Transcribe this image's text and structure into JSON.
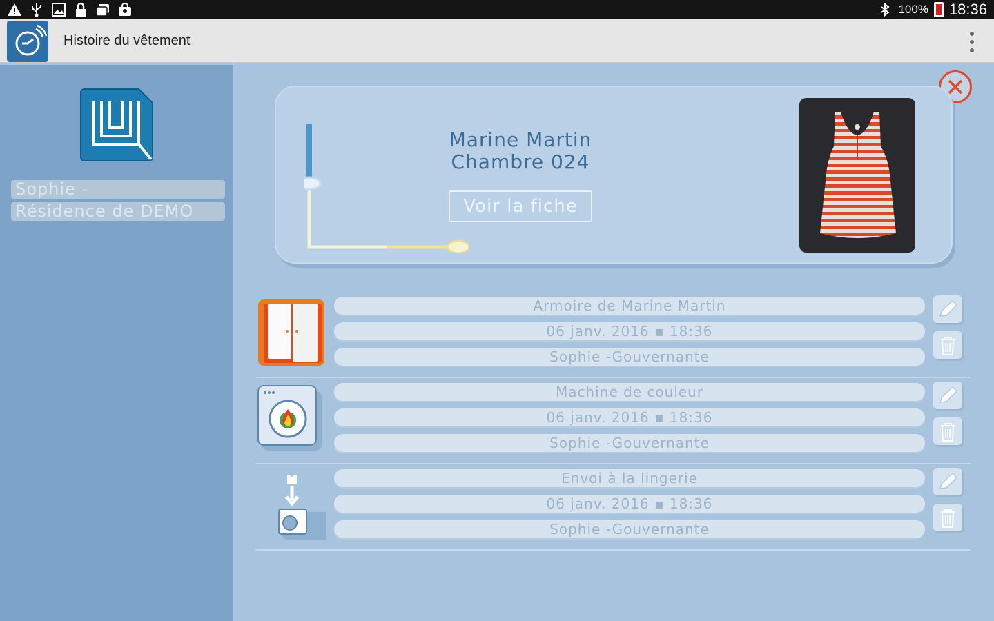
{
  "status_bar": {
    "battery_percent": "100%",
    "time": "18:36",
    "left_icons": [
      "warning-icon",
      "usb-icon",
      "image-icon",
      "lock-icon",
      "photos-icon",
      "shop-icon"
    ],
    "right_icons": [
      "bluetooth-icon",
      "battery-icon"
    ]
  },
  "action_bar": {
    "title": "Histoire du vêtement"
  },
  "sidebar": {
    "user_name": "Sophie   -",
    "residence": "Résidence de DEMO"
  },
  "card": {
    "owner_name": "Marine Martin",
    "room": "Chambre 024",
    "sheet_button": "Voir la fiche"
  },
  "history": [
    {
      "icon": "wardrobe-icon",
      "location": "Armoire de Marine Martin",
      "datetime": "06 janv. 2016 ▪ 18:36",
      "user": "Sophie  -Gouvernante"
    },
    {
      "icon": "washing-machine-icon",
      "location": "Machine de couleur",
      "datetime": "06 janv. 2016 ▪ 18:36",
      "user": "Sophie  -Gouvernante"
    },
    {
      "icon": "laundry-transfer-icon",
      "location": "Envoi à la lingerie",
      "datetime": "06 janv. 2016 ▪ 18:36",
      "user": "Sophie  -Gouvernante"
    }
  ],
  "colors": {
    "status_bar": "#141414",
    "action_bar": "#e6e6e6",
    "sidebar": "#7ea3c8",
    "main": "#a8c3dd",
    "accent_text": "#3d6c98",
    "close": "#e24a2e"
  }
}
